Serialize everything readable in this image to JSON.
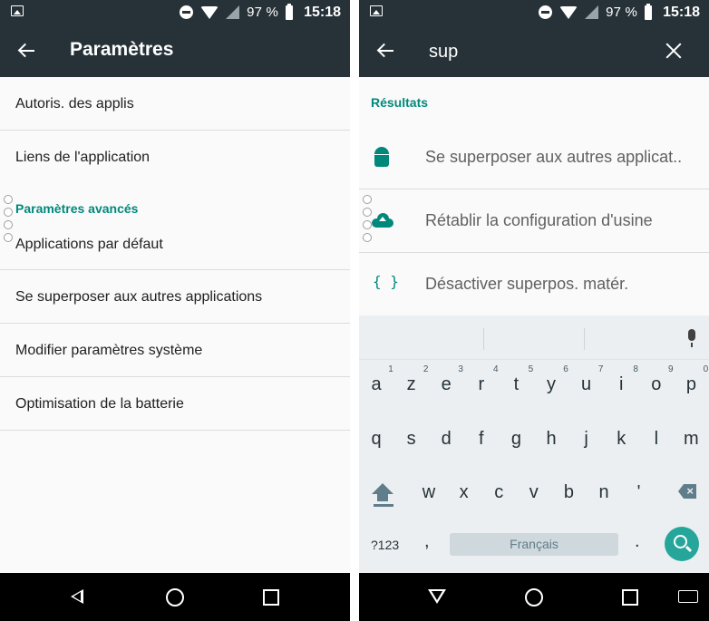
{
  "left": {
    "status": {
      "battery": "97 %",
      "time": "15:18"
    },
    "toolbar": {
      "title": "Paramètres"
    },
    "items_top": [
      "Autoris. des applis",
      "Liens de l'application"
    ],
    "section_title": "Paramètres avancés",
    "items_advanced": [
      "Applications par défaut",
      "Se superposer aux autres applications",
      "Modifier paramètres système",
      "Optimisation de la batterie"
    ]
  },
  "right": {
    "status": {
      "battery": "97 %",
      "time": "15:18"
    },
    "toolbar": {
      "query": "sup"
    },
    "results_title": "Résultats",
    "results": [
      {
        "label": "Se superposer aux autres applicat..",
        "icon": "android-icon"
      },
      {
        "label": "Rétablir la configuration d'usine",
        "icon": "cloud-upload-icon"
      },
      {
        "label": "Désactiver superpos. matér.",
        "icon": "braces-icon",
        "glyph": "{ }"
      }
    ],
    "keyboard": {
      "row1": [
        "a",
        "z",
        "e",
        "r",
        "t",
        "y",
        "u",
        "i",
        "o",
        "p"
      ],
      "row1_hints": [
        "1",
        "2",
        "3",
        "4",
        "5",
        "6",
        "7",
        "8",
        "9",
        "0"
      ],
      "row2": [
        "q",
        "s",
        "d",
        "f",
        "g",
        "h",
        "j",
        "k",
        "l",
        "m"
      ],
      "row3": [
        "w",
        "x",
        "c",
        "v",
        "b",
        "n",
        "'"
      ],
      "symbols_key": "?123",
      "comma": ",",
      "space_label": "Français",
      "period": "."
    }
  },
  "colors": {
    "toolbar": "#263238",
    "accent": "#00897b",
    "search_button": "#26a69a"
  }
}
